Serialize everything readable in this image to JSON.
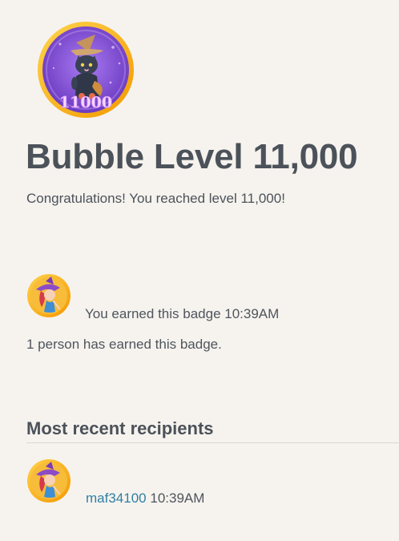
{
  "badge": {
    "icon": "cat-wizard-badge-icon",
    "level_text": "11000",
    "colors": {
      "ring": "#f6b10e",
      "inner": "#8a58d6",
      "text": "#f3d8ff"
    }
  },
  "page": {
    "title": "Bubble Level 11,000",
    "subtitle": "Congratulations! You reached level 11,000!"
  },
  "earned": {
    "avatar_icon": "witch-avatar-icon",
    "text": "You earned this badge 10:39AM",
    "count_text": "1 person has earned this badge."
  },
  "recent": {
    "section_title": "Most recent recipients",
    "items": [
      {
        "avatar_icon": "witch-avatar-icon",
        "username": "maf34100",
        "time": "10:39AM"
      }
    ]
  },
  "colors": {
    "background": "#f6f3ef",
    "text": "#4f555c",
    "link": "#2f7fa3",
    "divider": "#d9d6d3"
  }
}
